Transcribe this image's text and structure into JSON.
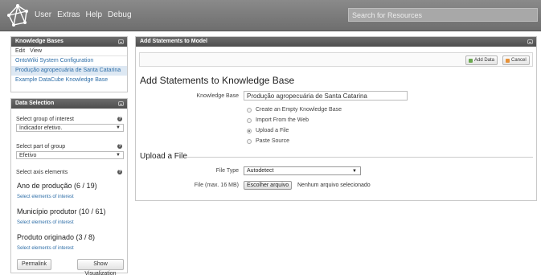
{
  "topbar": {
    "logo_icon": "ontowiki-logo-icon",
    "menu": [
      "User",
      "Extras",
      "Help",
      "Debug"
    ],
    "search_placeholder": "Search for Resources"
  },
  "knowledge_bases": {
    "title": "Knowledge Bases",
    "menu": [
      "Edit",
      "View"
    ],
    "items": [
      {
        "label": "OntoWiki System Configuration",
        "selected": false
      },
      {
        "label": "Produção agropecuária de Santa Catarina",
        "selected": true
      },
      {
        "label": "Example DataCube Knowledge Base",
        "selected": false
      }
    ]
  },
  "data_selection": {
    "title": "Data Selection",
    "group_label": "Select group of interest",
    "group_value": "Indicador efetivo.",
    "part_label": "Select part of group",
    "part_value": "Efetivo",
    "axis_label": "Select axis elements",
    "help_glyph": "?",
    "dimensions": [
      {
        "title": "Ano de produção  (6 / 19)",
        "link": "Select elements of interest"
      },
      {
        "title": "Município produtor  (10 / 61)",
        "link": "Select elements of interest"
      },
      {
        "title": "Produto originado  (3 / 8)",
        "link": "Select elements of interest"
      }
    ],
    "permalink_label": "Permalink",
    "show_viz_label": "Show Visualization"
  },
  "main": {
    "title": "Add Statements to Model",
    "add_data_label": "Add Data",
    "cancel_label": "Cancel",
    "heading": "Add Statements to Knowledge Base",
    "kb_label": "Knowledge Base",
    "kb_value": "Produção agropecuária de Santa Catarina",
    "options": [
      {
        "label": "Create an Empty Knowledge Base",
        "checked": false
      },
      {
        "label": "Import From the Web",
        "checked": false
      },
      {
        "label": "Upload a File",
        "checked": true
      },
      {
        "label": "Paste Source",
        "checked": false
      }
    ],
    "upload_heading": "Upload a File",
    "file_type_label": "File Type",
    "file_type_value": "Autodetect",
    "file_label": "File (max. 16 MB)",
    "choose_file_label": "Escolher arquivo",
    "file_status": "Nenhum arquivo selecionado"
  },
  "colors": {
    "topbar": "#7a7a7a",
    "panel_header": "#5a5a5a",
    "link": "#2f6fa8",
    "selected_bg": "#dde8f3"
  }
}
